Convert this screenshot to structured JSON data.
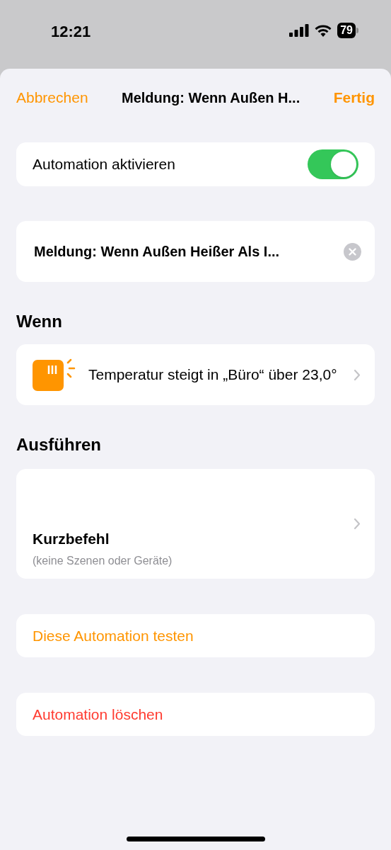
{
  "status_bar": {
    "time": "12:21",
    "battery": "79"
  },
  "nav": {
    "cancel": "Abbrechen",
    "title": "Meldung: Wenn Außen H...",
    "done": "Fertig"
  },
  "enable": {
    "label": "Automation aktivieren",
    "on": true
  },
  "name_field": {
    "value": "Meldung: Wenn Außen Heißer Als I..."
  },
  "when": {
    "heading": "Wenn",
    "trigger": "Temperatur steigt in „Büro“ über 23,0°"
  },
  "run": {
    "heading": "Ausführen",
    "title": "Kurzbefehl",
    "subtitle": "(keine Szenen oder Geräte)"
  },
  "actions": [
    {
      "label": "Diese Automation testen",
      "kind": "normal"
    },
    {
      "label": "Automation löschen",
      "kind": "destructive"
    }
  ]
}
